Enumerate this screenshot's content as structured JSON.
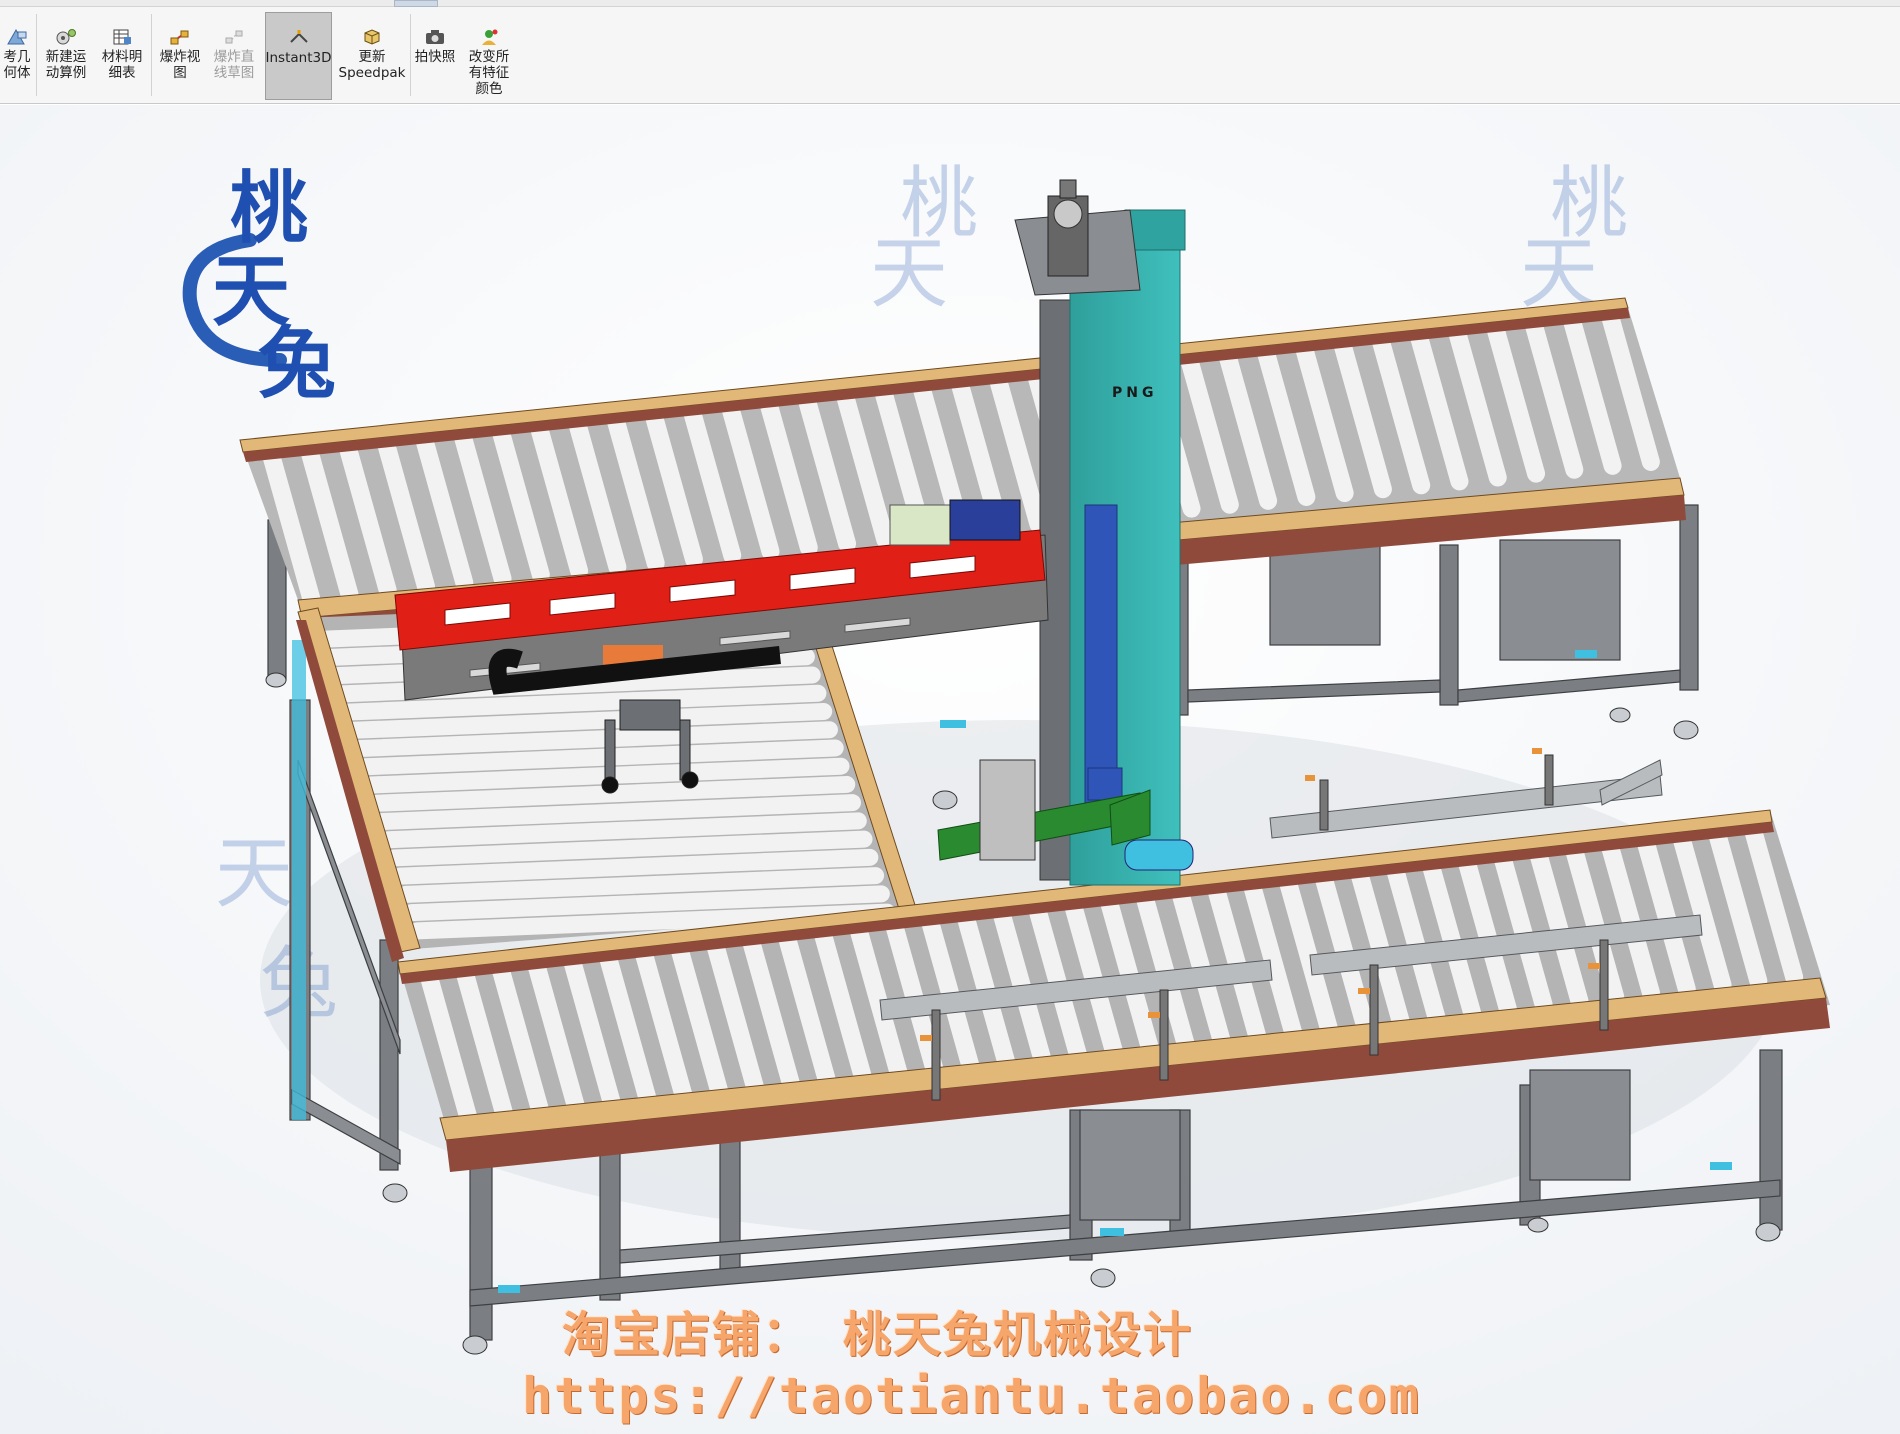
{
  "toolbar": {
    "buttons": [
      {
        "label": "考几\n何体",
        "icon": "reference-geometry-icon",
        "state": "normal"
      },
      {
        "label": "新建运\n动算例",
        "icon": "new-motion-study-icon",
        "state": "normal"
      },
      {
        "label": "材料明\n细表",
        "icon": "bill-of-materials-icon",
        "state": "normal"
      },
      {
        "label": "爆炸视\n图",
        "icon": "exploded-view-icon",
        "state": "normal"
      },
      {
        "label": "爆炸直\n线草图",
        "icon": "explode-line-sketch-icon",
        "state": "disabled"
      },
      {
        "label": "Instant3D",
        "icon": "instant3d-icon",
        "state": "active"
      },
      {
        "label": "更新\nSpeedpak",
        "icon": "update-speedpak-icon",
        "state": "normal"
      },
      {
        "label": "拍快照",
        "icon": "take-snapshot-icon",
        "state": "normal"
      },
      {
        "label": "改变所\n有特征\n颜色",
        "icon": "change-feature-colors-icon",
        "state": "normal"
      }
    ]
  },
  "view_toolbar": {
    "icons": [
      "zoom-to-fit-icon",
      "zoom-to-area-icon",
      "previous-view-icon",
      "section-view-icon",
      "dynamic-annotation-icon",
      "view-orientation-icon",
      "display-style-icon",
      "hide-show-items-icon",
      "edit-appearance-icon",
      "apply-scene-icon",
      "view-settings-icon"
    ]
  },
  "watermark": {
    "logo_text": "桃天兔",
    "shop_line": "淘宝店铺：  桃天兔机械设计",
    "url_line": "https://taotiantu.taobao.com"
  },
  "model": {
    "column_label": "PNG",
    "colors": {
      "roller": "#f4f4f4",
      "roller_shadow": "#b9b9b9",
      "rail_wood": "#e2b878",
      "rail_red": "#8f4a3c",
      "frame": "#7b7e82",
      "column_teal": "#2fa39f",
      "column_blue": "#2f55b8",
      "beam_red": "#e01f16",
      "beam_gray": "#7a7a7a",
      "guide_green": "#2a8a30",
      "accent_cyan": "#3fc0e0"
    }
  }
}
